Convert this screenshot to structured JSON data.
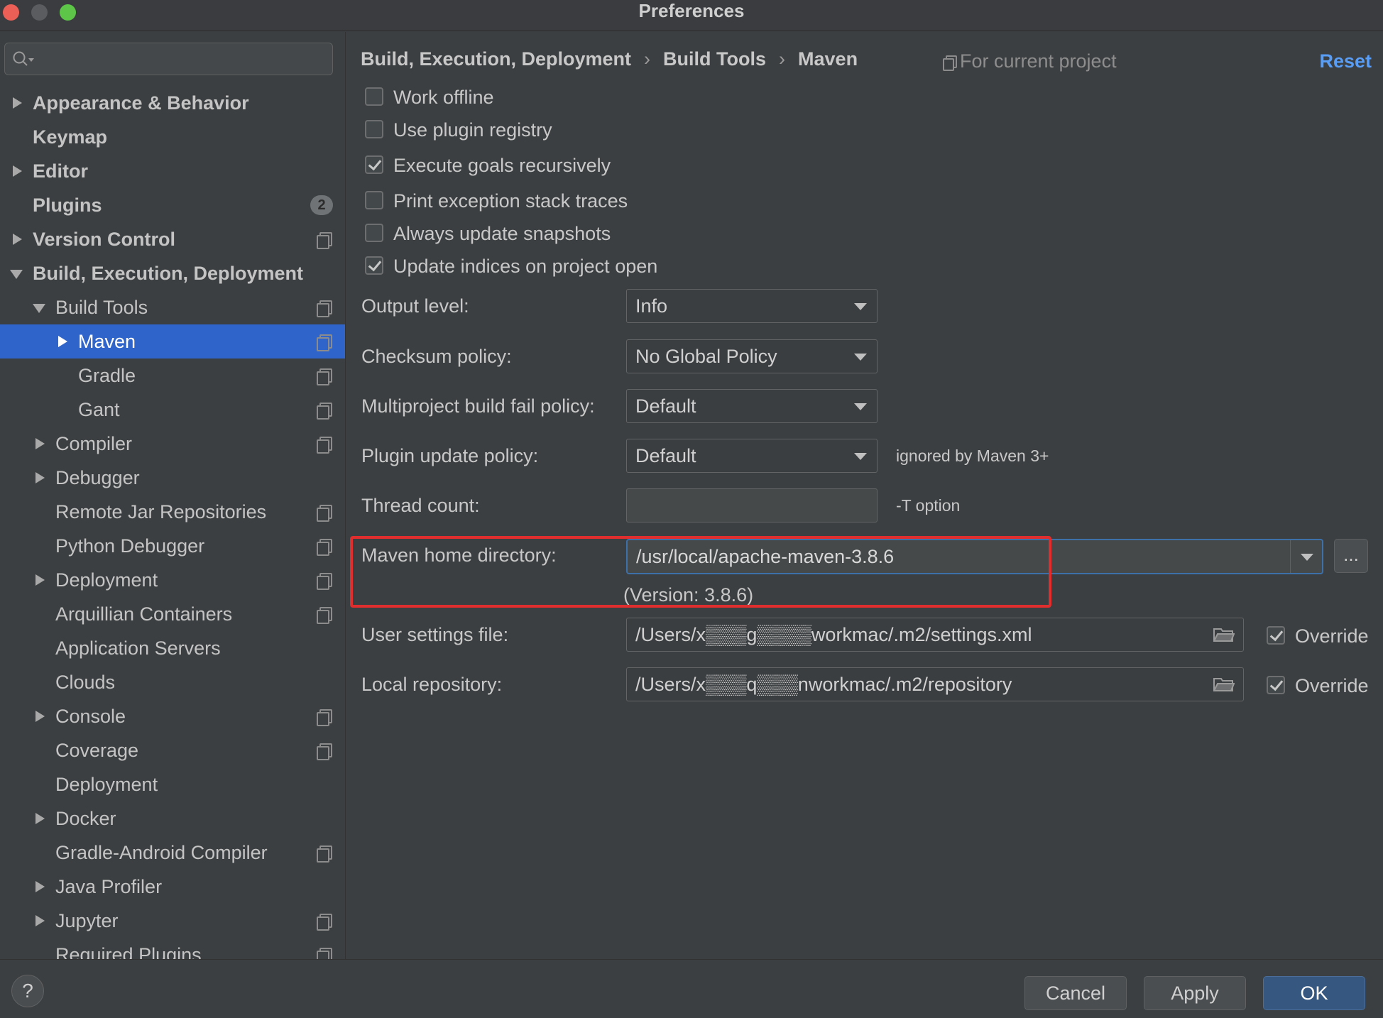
{
  "window": {
    "title": "Preferences"
  },
  "search": {
    "placeholder": ""
  },
  "sidebar": {
    "items": [
      {
        "label": "Appearance & Behavior",
        "level": 0,
        "arrow": "right",
        "bold": true,
        "proj": false
      },
      {
        "label": "Keymap",
        "level": 0,
        "arrow": "none",
        "bold": true,
        "proj": false
      },
      {
        "label": "Editor",
        "level": 0,
        "arrow": "right",
        "bold": true,
        "proj": false
      },
      {
        "label": "Plugins",
        "level": 0,
        "arrow": "none",
        "bold": true,
        "proj": false,
        "badge": "2"
      },
      {
        "label": "Version Control",
        "level": 0,
        "arrow": "right",
        "bold": true,
        "proj": true
      },
      {
        "label": "Build, Execution, Deployment",
        "level": 0,
        "arrow": "down",
        "bold": true,
        "proj": false
      },
      {
        "label": "Build Tools",
        "level": 1,
        "arrow": "down",
        "bold": false,
        "proj": true
      },
      {
        "label": "Maven",
        "level": 2,
        "arrow": "right",
        "bold": false,
        "proj": true,
        "selected": true
      },
      {
        "label": "Gradle",
        "level": 2,
        "arrow": "none",
        "bold": false,
        "proj": true
      },
      {
        "label": "Gant",
        "level": 2,
        "arrow": "none",
        "bold": false,
        "proj": true
      },
      {
        "label": "Compiler",
        "level": 1,
        "arrow": "right",
        "bold": false,
        "proj": true
      },
      {
        "label": "Debugger",
        "level": 1,
        "arrow": "right",
        "bold": false,
        "proj": false
      },
      {
        "label": "Remote Jar Repositories",
        "level": 1,
        "arrow": "none",
        "bold": false,
        "proj": true
      },
      {
        "label": "Python Debugger",
        "level": 1,
        "arrow": "none",
        "bold": false,
        "proj": true
      },
      {
        "label": "Deployment",
        "level": 1,
        "arrow": "right",
        "bold": false,
        "proj": true
      },
      {
        "label": "Arquillian Containers",
        "level": 1,
        "arrow": "none",
        "bold": false,
        "proj": true
      },
      {
        "label": "Application Servers",
        "level": 1,
        "arrow": "none",
        "bold": false,
        "proj": false
      },
      {
        "label": "Clouds",
        "level": 1,
        "arrow": "none",
        "bold": false,
        "proj": false
      },
      {
        "label": "Console",
        "level": 1,
        "arrow": "right",
        "bold": false,
        "proj": true
      },
      {
        "label": "Coverage",
        "level": 1,
        "arrow": "none",
        "bold": false,
        "proj": true
      },
      {
        "label": "Deployment",
        "level": 1,
        "arrow": "none",
        "bold": false,
        "proj": false
      },
      {
        "label": "Docker",
        "level": 1,
        "arrow": "right",
        "bold": false,
        "proj": false
      },
      {
        "label": "Gradle-Android Compiler",
        "level": 1,
        "arrow": "none",
        "bold": false,
        "proj": true
      },
      {
        "label": "Java Profiler",
        "level": 1,
        "arrow": "right",
        "bold": false,
        "proj": false
      },
      {
        "label": "Jupyter",
        "level": 1,
        "arrow": "right",
        "bold": false,
        "proj": true
      },
      {
        "label": "Required Plugins",
        "level": 1,
        "arrow": "none",
        "bold": false,
        "proj": true
      }
    ]
  },
  "header": {
    "crumb1": "Build, Execution, Deployment",
    "crumb2": "Build Tools",
    "crumb3": "Maven",
    "separator": "›",
    "scope": "For current project",
    "reset": "Reset"
  },
  "options": {
    "work_offline": {
      "label": "Work offline",
      "checked": false
    },
    "plugin_registry": {
      "label": "Use plugin registry",
      "checked": false
    },
    "recursive": {
      "label": "Execute goals recursively",
      "checked": true
    },
    "stack_traces": {
      "label": "Print exception stack traces",
      "checked": false
    },
    "update_snapshots": {
      "label": "Always update snapshots",
      "checked": false
    },
    "update_indices": {
      "label": "Update indices on project open",
      "checked": true
    }
  },
  "fields": {
    "output_level": {
      "label": "Output level:",
      "value": "Info"
    },
    "checksum": {
      "label": "Checksum policy:",
      "value": "No Global Policy"
    },
    "multiproject": {
      "label": "Multiproject build fail policy:",
      "value": "Default"
    },
    "plugin_update": {
      "label": "Plugin update policy:",
      "value": "Default",
      "hint": "ignored by Maven 3+"
    },
    "thread_count": {
      "label": "Thread count:",
      "value": "",
      "hint": "-T option"
    },
    "maven_home": {
      "label": "Maven home directory:",
      "value": "/usr/local/apache-maven-3.8.6",
      "version": "(Version: 3.8.6)",
      "browse": "..."
    },
    "user_settings": {
      "label": "User settings file:",
      "value": "/Users/x▒▒▒g▒▒▒▒workmac/.m2/settings.xml",
      "override": "Override",
      "override_checked": true
    },
    "local_repo": {
      "label": "Local repository:",
      "value": "/Users/x▒▒▒q▒▒▒nworkmac/.m2/repository",
      "override": "Override",
      "override_checked": true
    }
  },
  "footer": {
    "help": "?",
    "cancel": "Cancel",
    "apply": "Apply",
    "ok": "OK"
  },
  "colors": {
    "accent": "#2f65ca",
    "link": "#589df6",
    "highlight": "#e02e2e",
    "ok_button": "#365880"
  }
}
